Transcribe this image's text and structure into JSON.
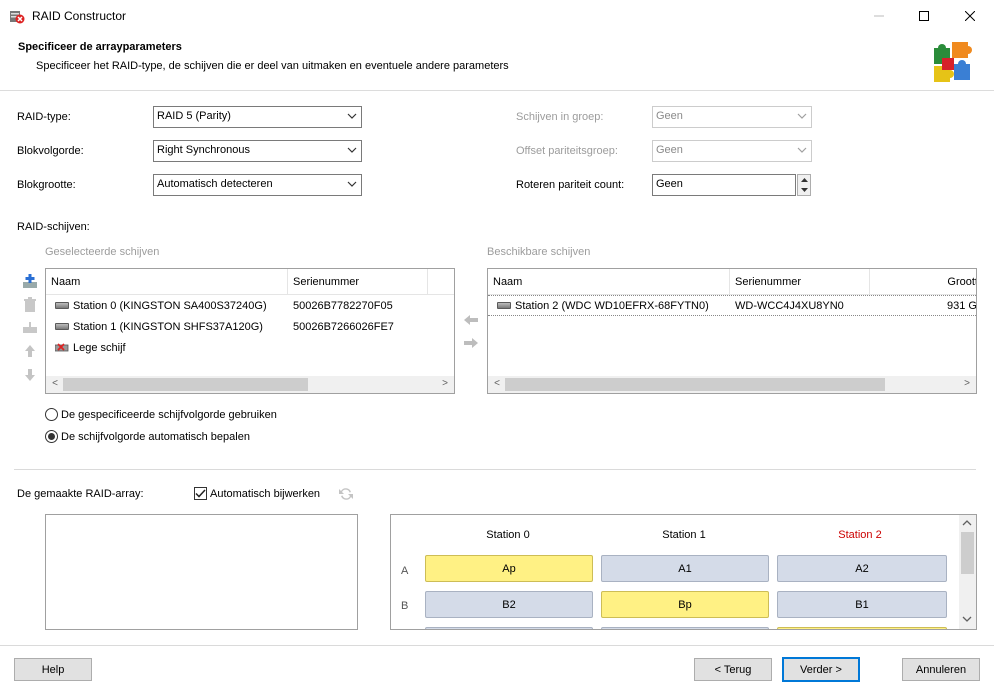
{
  "window": {
    "title": "RAID Constructor",
    "minimize": "—",
    "maximize": "☐",
    "close": "✕"
  },
  "header": {
    "title": "Specificeer de arrayparameters",
    "subtitle": "Specificeer het RAID-type, de schijven die er deel van uitmaken en eventuele andere parameters"
  },
  "params": {
    "raid_type_label": "RAID-type:",
    "raid_type_value": "RAID 5 (Parity)",
    "block_order_label": "Blokvolgorde:",
    "block_order_value": "Right Synchronous",
    "block_size_label": "Blokgrootte:",
    "block_size_value": "Automatisch detecteren",
    "disks_in_group_label": "Schijven in groep:",
    "disks_in_group_value": "Geen",
    "offset_parity_label": "Offset pariteitsgroep:",
    "offset_parity_value": "Geen",
    "rotate_parity_label": "Roteren pariteit count:",
    "rotate_parity_value": "Geen"
  },
  "raid_disks": {
    "section_label": "RAID-schijven:",
    "selected": {
      "group_label": "Geselecteerde schijven",
      "columns": [
        "Naam",
        "Serienummer"
      ],
      "rows": [
        {
          "name": "Station 0 (KINGSTON SA400S37240G)",
          "serial": "50026B7782270F05"
        },
        {
          "name": "Station 1 (KINGSTON SHFS37A120G)",
          "serial": "50026B7266026FE7"
        },
        {
          "name": "Lege schijf",
          "serial": ""
        }
      ]
    },
    "available": {
      "group_label": "Beschikbare schijven",
      "columns": [
        "Naam",
        "Serienummer",
        "Groott"
      ],
      "rows": [
        {
          "name": "Station 2 (WDC WD10EFRX-68FYTN0)",
          "serial": "WD-WCC4J4XU8YN0",
          "size": "931 G"
        }
      ]
    }
  },
  "order": {
    "option_manual": "De gespecificeerde schijfvolgorde gebruiken",
    "option_auto": "De schijfvolgorde automatisch bepalen",
    "selected": "auto"
  },
  "array": {
    "label": "De gemaakte RAID-array:",
    "auto_update_label": "Automatisch bijwerken",
    "auto_update_checked": true,
    "columns": [
      "Station 0",
      "Station 1",
      "Station 2"
    ],
    "rows": [
      {
        "label": "A",
        "cells": [
          {
            "text": "Ap",
            "kind": "parity"
          },
          {
            "text": "A1",
            "kind": "data"
          },
          {
            "text": "A2",
            "kind": "data"
          }
        ]
      },
      {
        "label": "B",
        "cells": [
          {
            "text": "B2",
            "kind": "data"
          },
          {
            "text": "Bp",
            "kind": "parity"
          },
          {
            "text": "B1",
            "kind": "data"
          }
        ]
      }
    ],
    "colors": {
      "data": "#d4dbe8",
      "parity": "#fff184",
      "new_disk": "#cc0000"
    }
  },
  "footer": {
    "help": "Help",
    "back": "< Terug",
    "next": "Verder >",
    "cancel": "Annuleren"
  }
}
